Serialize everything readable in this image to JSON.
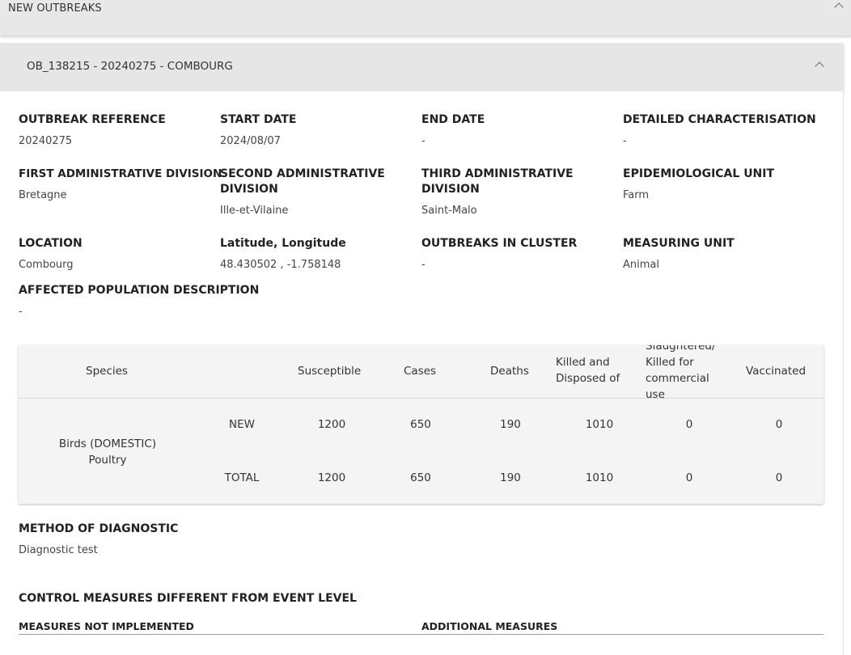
{
  "panel": {
    "title": "NEW OUTBREAKS"
  },
  "outbreak": {
    "title": "OB_138215 - 20240275 - COMBOURG"
  },
  "fields": {
    "outbreak_reference": {
      "label": "OUTBREAK REFERENCE",
      "value": "20240275"
    },
    "start_date": {
      "label": "START DATE",
      "value": "2024/08/07"
    },
    "end_date": {
      "label": "END DATE",
      "value": "-"
    },
    "detailed_characterisation": {
      "label": "DETAILED CHARACTERISATION",
      "value": "-"
    },
    "first_admin_division": {
      "label": "FIRST ADMINISTRATIVE DIVISION",
      "value": "Bretagne"
    },
    "second_admin_division": {
      "label": "SECOND ADMINISTRATIVE DIVISION",
      "value": "Ille-et-Vilaine"
    },
    "third_admin_division": {
      "label": "THIRD ADMINISTRATIVE DIVISION",
      "value": "Saint-Malo"
    },
    "epidemiological_unit": {
      "label": "EPIDEMIOLOGICAL UNIT",
      "value": "Farm"
    },
    "location": {
      "label": "LOCATION",
      "value": "Combourg"
    },
    "lat_long": {
      "label": "Latitude, Longitude",
      "value": "48.430502 , -1.758148"
    },
    "outbreaks_in_cluster": {
      "label": "OUTBREAKS IN CLUSTER",
      "value": "-"
    },
    "measuring_unit": {
      "label": "MEASURING UNIT",
      "value": "Animal"
    },
    "affected_population": {
      "label": "AFFECTED POPULATION DESCRIPTION",
      "value": "-"
    },
    "method_of_diagnostic": {
      "label": "METHOD OF DIAGNOSTIC",
      "value": "Diagnostic test"
    }
  },
  "table": {
    "headers": {
      "species": "Species",
      "susceptible": "Susceptible",
      "cases": "Cases",
      "deaths": "Deaths",
      "killed_line1": "Killed and",
      "killed_line2": "Disposed of",
      "slaughtered_line1": "Slaughtered/",
      "slaughtered_line2": "Killed for",
      "slaughtered_line3": "commercial",
      "slaughtered_line4": "use",
      "vaccinated": "Vaccinated"
    },
    "species_line1": "Birds (DOMESTIC)",
    "species_line2": "Poultry",
    "rows": [
      {
        "type": "NEW",
        "susceptible": "1200",
        "cases": "650",
        "deaths": "190",
        "killed": "1010",
        "slaughtered": "0",
        "vaccinated": "0"
      },
      {
        "type": "TOTAL",
        "susceptible": "1200",
        "cases": "650",
        "deaths": "190",
        "killed": "1010",
        "slaughtered": "0",
        "vaccinated": "0"
      }
    ]
  },
  "control_measures": {
    "title": "CONTROL MEASURES DIFFERENT FROM EVENT LEVEL",
    "not_implemented": "MEASURES NOT IMPLEMENTED",
    "additional": "ADDITIONAL MEASURES"
  }
}
